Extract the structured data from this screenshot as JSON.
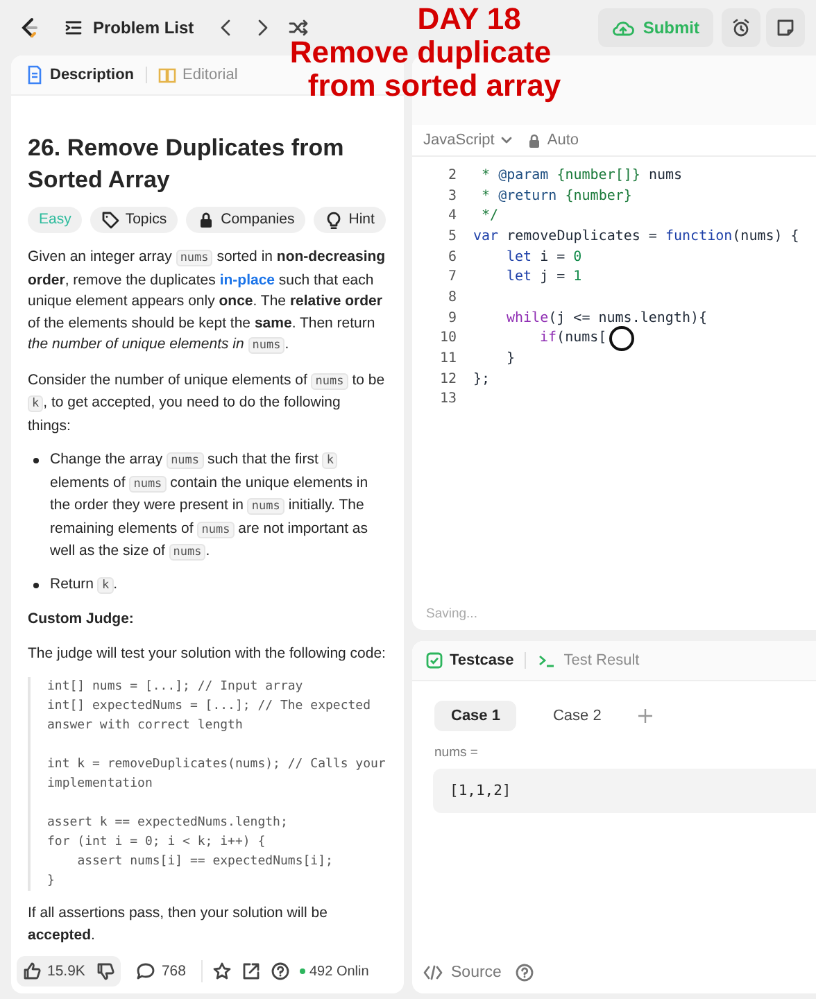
{
  "top_bar": {
    "problem_list": "Problem List",
    "submit": "Submit"
  },
  "caption": {
    "lines": [
      "DAY 18",
      "Remove duplicate",
      "from sorted array"
    ]
  },
  "left_tabs": [
    {
      "label": "Description",
      "selected": true
    },
    {
      "label": "Editorial",
      "selected": false
    }
  ],
  "problem": {
    "title": "26. Remove Duplicates from Sorted Array",
    "tags": [
      {
        "label": "Easy",
        "kind": "difficulty"
      },
      {
        "label": "Topics",
        "kind": "tag"
      },
      {
        "label": "Companies",
        "kind": "lock"
      },
      {
        "label": "Hint",
        "kind": "bulb"
      }
    ],
    "blocks": [
      {
        "kind": "para",
        "segments": [
          {
            "kind": "text",
            "text": "Given an integer array "
          },
          {
            "kind": "code",
            "text": "nums"
          },
          {
            "kind": "text",
            "text": " sorted in **non-decreasing order**, remove the duplicates "
          },
          {
            "kind": "link",
            "text": "in-place"
          },
          {
            "kind": "text",
            "text": " such that each unique element appears only **once**. The **relative order** of the elements should be kept the **same**. Then return *the number of unique elements in* "
          },
          {
            "kind": "code",
            "text": "nums"
          },
          {
            "kind": "text",
            "text": "."
          }
        ]
      },
      {
        "kind": "para",
        "segments": [
          {
            "kind": "text",
            "text": "Consider the number of unique elements of "
          },
          {
            "kind": "code",
            "text": "nums"
          },
          {
            "kind": "text",
            "text": " to be "
          },
          {
            "kind": "code",
            "text": "k"
          },
          {
            "kind": "text",
            "text": ", to get accepted, you need to do the following things:"
          }
        ]
      },
      {
        "kind": "bullet",
        "segments": [
          {
            "kind": "text",
            "text": "Change the array "
          },
          {
            "kind": "code",
            "text": "nums"
          },
          {
            "kind": "text",
            "text": " such that the first "
          },
          {
            "kind": "code",
            "text": "k"
          },
          {
            "kind": "text",
            "text": " elements of "
          },
          {
            "kind": "code",
            "text": "nums"
          },
          {
            "kind": "text",
            "text": " contain the unique elements in the order they were present in "
          },
          {
            "kind": "code",
            "text": "nums"
          },
          {
            "kind": "text",
            "text": " initially. The remaining elements of "
          },
          {
            "kind": "code",
            "text": "nums"
          },
          {
            "kind": "text",
            "text": " are not important as well as the size of "
          },
          {
            "kind": "code",
            "text": "nums"
          },
          {
            "kind": "text",
            "text": "."
          }
        ]
      },
      {
        "kind": "bullet",
        "segments": [
          {
            "kind": "text",
            "text": "Return "
          },
          {
            "kind": "code",
            "text": "k"
          },
          {
            "kind": "text",
            "text": "."
          }
        ]
      },
      {
        "kind": "heading",
        "segments": [
          {
            "kind": "text",
            "text": "Custom Judge:"
          }
        ]
      },
      {
        "kind": "para",
        "segments": [
          {
            "kind": "text",
            "text": "The judge will test your solution with the following code:"
          }
        ]
      },
      {
        "kind": "pre",
        "segments": [
          {
            "kind": "text",
            "text": "int[] nums = [...]; // Input array\nint[] expectedNums = [...]; // The expected answer with correct length\n\nint k = removeDuplicates(nums); // Calls your implementation\n\nassert k == expectedNums.length;\nfor (int i = 0; i < k; i++) {\n    assert nums[i] == expectedNums[i];\n}"
          }
        ]
      },
      {
        "kind": "para",
        "segments": [
          {
            "kind": "text",
            "text": "If all assertions pass, then your solution will be **accepted**."
          }
        ]
      }
    ]
  },
  "left_footer": {
    "likes": "15.9K",
    "comments": "768",
    "online": "492 Onlin"
  },
  "editor": {
    "language": "JavaScript",
    "mode": "Auto",
    "status": "Saving...",
    "lines": [
      {
        "num": "2",
        "tokens": [
          {
            "kind": "comment",
            "text": " * "
          },
          {
            "kind": "tag",
            "text": "@param"
          },
          {
            "kind": "comment",
            "text": " {number[]} "
          },
          {
            "kind": "plain",
            "text": "nums"
          }
        ]
      },
      {
        "num": "3",
        "tokens": [
          {
            "kind": "comment",
            "text": " * "
          },
          {
            "kind": "tag",
            "text": "@return"
          },
          {
            "kind": "comment",
            "text": " {number}"
          }
        ]
      },
      {
        "num": "4",
        "tokens": [
          {
            "kind": "comment",
            "text": " */"
          }
        ]
      },
      {
        "num": "5",
        "tokens": [
          {
            "kind": "keyword",
            "text": "var"
          },
          {
            "kind": "plain",
            "text": " removeDuplicates = "
          },
          {
            "kind": "keyword",
            "text": "function"
          },
          {
            "kind": "plain",
            "text": "(nums) {"
          }
        ]
      },
      {
        "num": "6",
        "kind": "block",
        "tokens": [
          {
            "kind": "keyword",
            "text": "let"
          },
          {
            "kind": "plain",
            "text": " i = "
          },
          {
            "kind": "number",
            "text": "0"
          }
        ]
      },
      {
        "num": "7",
        "kind": "block",
        "tokens": [
          {
            "kind": "keyword",
            "text": "let"
          },
          {
            "kind": "plain",
            "text": " j = "
          },
          {
            "kind": "number",
            "text": "1"
          }
        ]
      },
      {
        "num": "8"
      },
      {
        "num": "9",
        "kind": "block",
        "tokens": [
          {
            "kind": "control",
            "text": "while"
          },
          {
            "kind": "plain",
            "text": "(j <= nums.length){"
          }
        ]
      },
      {
        "num": "10",
        "kind": "nested",
        "cursor": true,
        "tokens": [
          {
            "kind": "control",
            "text": "if"
          },
          {
            "kind": "plain",
            "text": "(nums["
          }
        ]
      },
      {
        "num": "11",
        "kind": "block",
        "tokens": [
          {
            "kind": "plain",
            "text": "}"
          }
        ]
      },
      {
        "num": "12",
        "tokens": [
          {
            "kind": "plain",
            "text": "};"
          }
        ]
      },
      {
        "num": "13"
      }
    ]
  },
  "test_tabs": [
    {
      "label": "Testcase",
      "selected": true
    },
    {
      "label": "Test Result",
      "selected": false
    }
  ],
  "cases": [
    {
      "label": "Case 1",
      "selected": true
    },
    {
      "label": "Case 2",
      "selected": false
    }
  ],
  "input": {
    "label": "nums =",
    "value": "[1,1,2]"
  },
  "right_footer": {
    "source": "Source"
  }
}
